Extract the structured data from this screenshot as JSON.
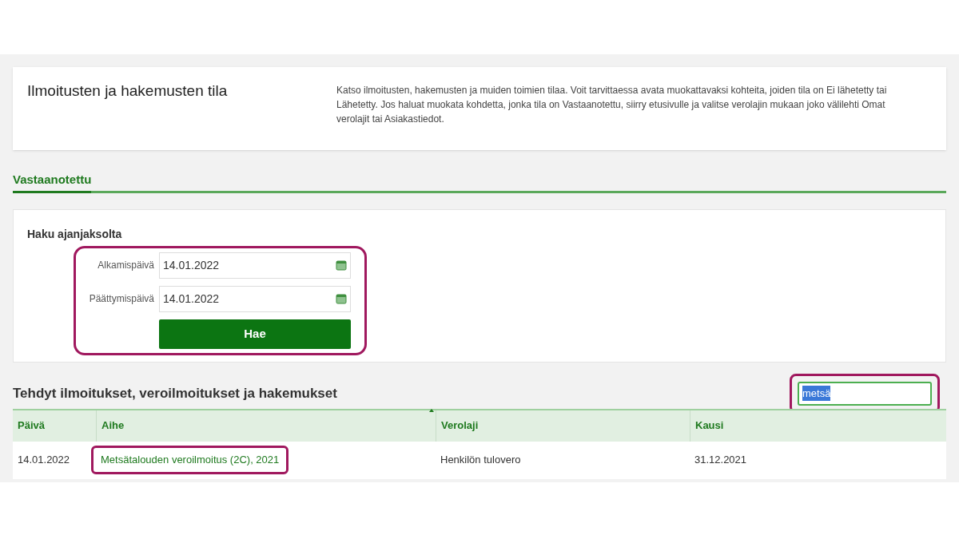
{
  "header": {
    "title": "Ilmoitusten ja hakemusten tila",
    "description": "Katso ilmoitusten, hakemusten ja muiden toimien tilaa. Voit tarvittaessa avata muokattavaksi kohteita, joiden tila on Ei lähetetty tai Lähetetty. Jos haluat muokata kohdetta, jonka tila on Vastaanotettu, siirry etusivulle ja valitse verolajin mukaan joko välilehti Omat verolajit tai Asiakastiedot."
  },
  "tabs": [
    {
      "label": "Vastaanotettu",
      "selected": true
    }
  ],
  "search_period": {
    "title": "Haku ajanjaksolta",
    "fields": [
      {
        "label": "Alkamispäivä",
        "value": "14.01.2022"
      },
      {
        "label": "Päättymispäivä",
        "value": "14.01.2022"
      }
    ],
    "button": "Hae"
  },
  "results": {
    "title": "Tehdyt ilmoitukset, veroilmoitukset ja hakemukset",
    "filter": {
      "value": "metsä",
      "text_selected": true
    },
    "columns": [
      {
        "label": "Päivä",
        "sorted": false
      },
      {
        "label": "Aihe",
        "sorted": true
      },
      {
        "label": "Verolaji",
        "sorted": false
      },
      {
        "label": "Kausi",
        "sorted": false
      }
    ],
    "rows": [
      [
        "14.01.2022",
        "Metsätalouden veroilmoitus (2C), 2021",
        "Henkilön tulovero",
        "31.12.2021"
      ]
    ]
  }
}
